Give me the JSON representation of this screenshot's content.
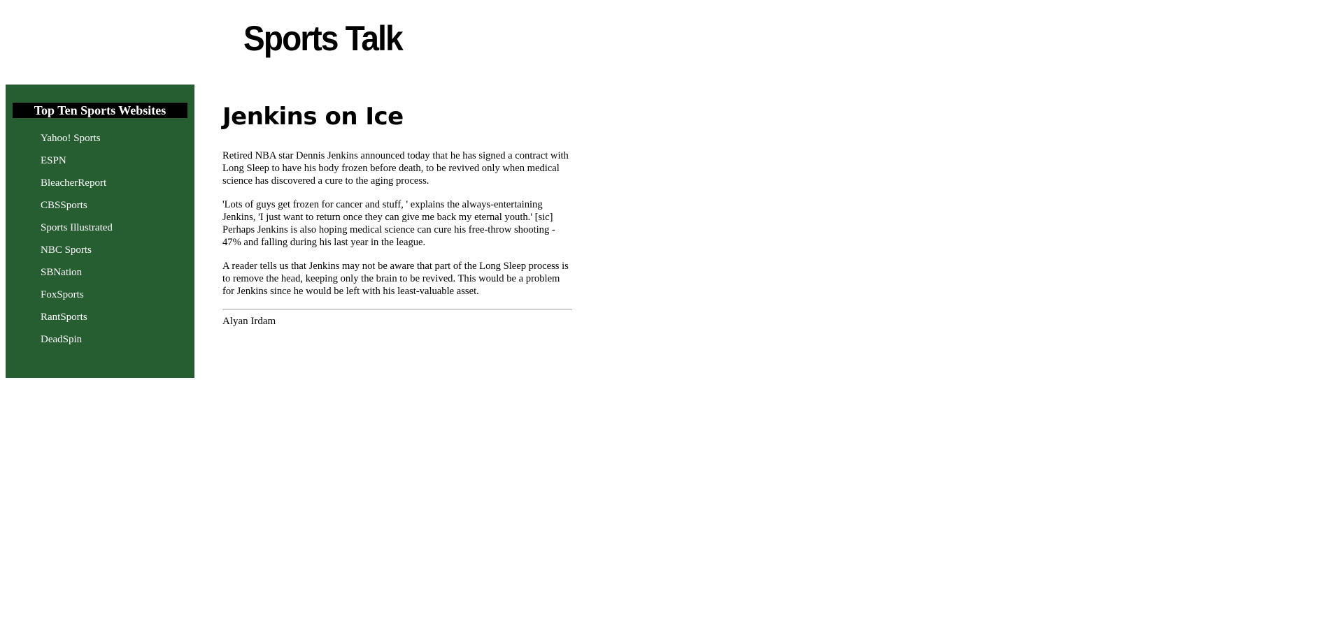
{
  "header": {
    "logo_text": "Sports Talk"
  },
  "sidebar": {
    "title": "Top Ten Sports Websites",
    "links": [
      "Yahoo! Sports",
      "ESPN",
      "BleacherReport",
      "CBSSports",
      "Sports Illustrated",
      "NBC Sports",
      "SBNation",
      "FoxSports",
      "RantSports",
      "DeadSpin"
    ]
  },
  "article": {
    "title": "Jenkins on Ice",
    "paragraphs": [
      "Retired NBA star Dennis Jenkins announced today that he has signed a contract with Long Sleep to have his body frozen before death, to be revived only when medical science has discovered a cure to the aging process.",
      "'Lots of guys get frozen for cancer and stuff, ' explains the always-entertaining Jenkins, 'I just want to return once they can give me back my eternal youth.' [sic] Perhaps Jenkins is also hoping medical science can cure his free-throw shooting - 47% and falling during his last year in the league.",
      "A reader tells us that Jenkins may not be aware that part of the Long Sleep process is to remove the head, keeping only the brain to be revived. This would be a problem for Jenkins since he would be left with his least-valuable asset."
    ],
    "byline": "Alyan Irdam"
  },
  "colors": {
    "sidebar_background": "#265e31",
    "sidebar_title_background": "#000000",
    "link_color": "#ffffff"
  }
}
